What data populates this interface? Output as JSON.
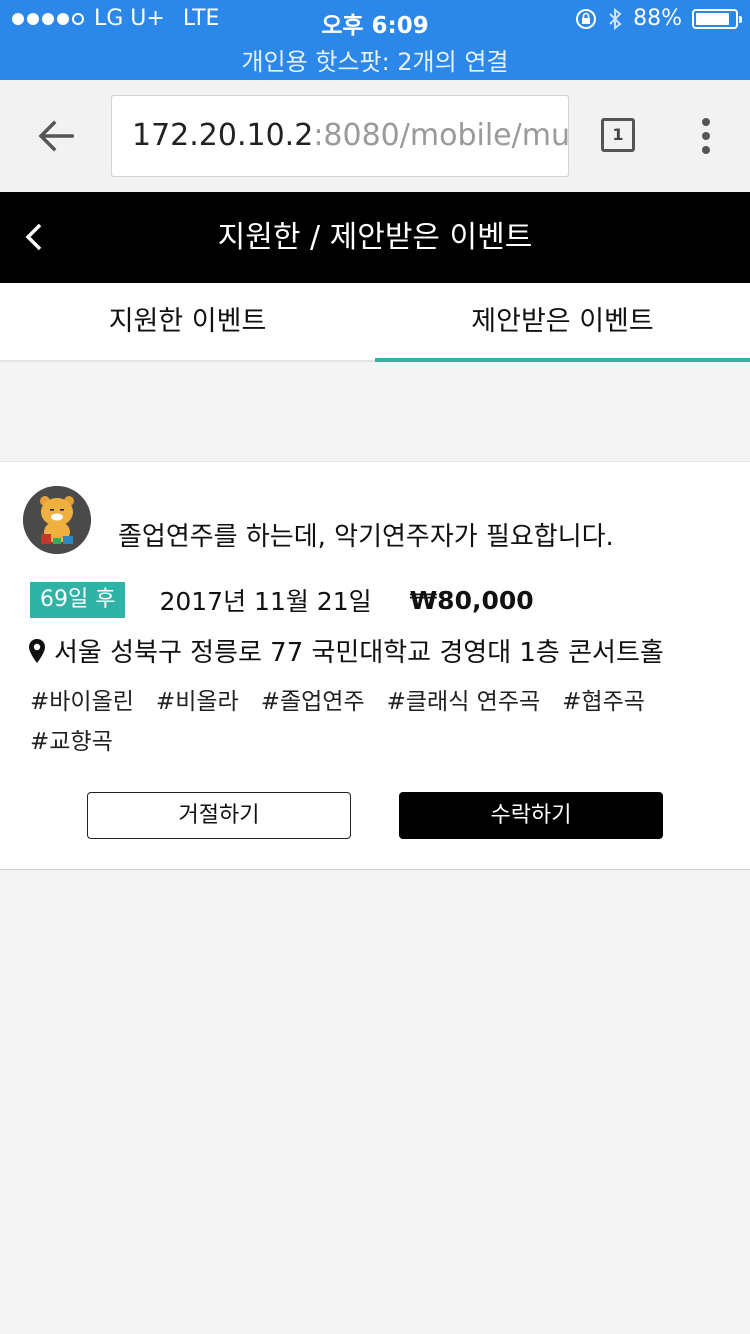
{
  "status_bar": {
    "carrier": "LG U+",
    "network": "LTE",
    "time": "오후 6:09",
    "battery": "88%",
    "battery_level": 0.88,
    "hotspot": "개인용 핫스팟: 2개의 연결"
  },
  "browser": {
    "url_host": "172.20.10.2",
    "url_rest": ":8080/mobile/mus",
    "tab_count": "1"
  },
  "header": {
    "title": "지원한 / 제안받은 이벤트"
  },
  "tabs": [
    {
      "label": "지원한 이벤트",
      "active": false
    },
    {
      "label": "제안받은 이벤트",
      "active": true
    }
  ],
  "event": {
    "title": "졸업연주를 하는데, 악기연주자가 필요합니다.",
    "dday": "69일 후",
    "date": "2017년 11월 21일",
    "price": "₩80,000",
    "location": "서울 성북구 정릉로 77 국민대학교 경영대 1층 콘서트홀",
    "tags": [
      "#바이올린",
      "#비올라",
      "#졸업연주",
      "#클래식 연주곡",
      "#협주곡",
      "#교향곡"
    ],
    "reject_label": "거절하기",
    "accept_label": "수락하기"
  },
  "colors": {
    "status_bar": "#2b88e8",
    "accent": "#2fb3a6",
    "header_bg": "#000000"
  }
}
